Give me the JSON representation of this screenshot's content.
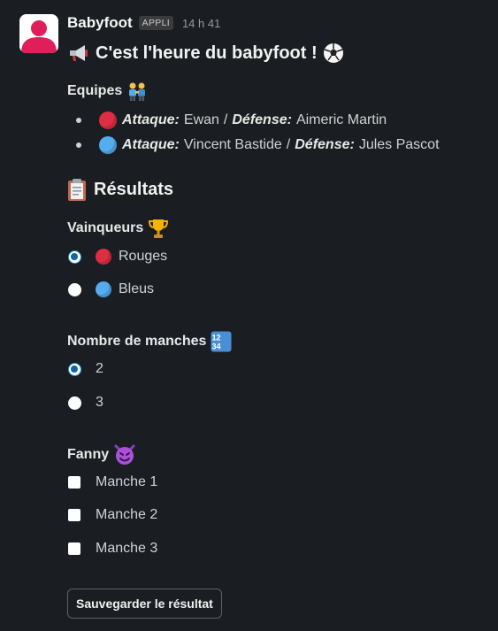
{
  "message": {
    "sender": "Babyfoot",
    "app_badge": "APPLI",
    "time": "14 h 41",
    "title_text": "C'est l'heure du babyfoot !",
    "title_icons": [
      "megaphone-icon",
      "soccer-ball-icon"
    ]
  },
  "teams": {
    "label": "Equipes",
    "label_icon": "two-people-icon",
    "items": [
      {
        "color_icon": "red-circle-icon",
        "color": "#dd2e44",
        "attack_label": "Attaque:",
        "attack": "Ewan",
        "separator": "/",
        "defense_label": "Défense:",
        "defense": "Aimeric Martin"
      },
      {
        "color_icon": "blue-circle-icon",
        "color": "#55acee",
        "attack_label": "Attaque:",
        "attack": "Vincent Bastide",
        "separator": "/",
        "defense_label": "Défense:",
        "defense": "Jules Pascot"
      }
    ]
  },
  "results": {
    "heading": "Résultats",
    "heading_icon": "clipboard-icon",
    "winners": {
      "label": "Vainqueurs",
      "label_icon": "trophy-icon",
      "options": [
        {
          "label": "Rouges",
          "color": "#dd2e44",
          "selected": true
        },
        {
          "label": "Bleus",
          "color": "#55acee",
          "selected": false
        }
      ]
    },
    "rounds": {
      "label": "Nombre de manches",
      "label_icon": "numbers-1234-icon",
      "icon_text": "1234",
      "options": [
        {
          "label": "2",
          "selected": true
        },
        {
          "label": "3",
          "selected": false
        }
      ]
    },
    "fanny": {
      "label": "Fanny",
      "label_icon": "smiling-imp-icon",
      "options": [
        {
          "label": "Manche 1",
          "checked": false
        },
        {
          "label": "Manche 2",
          "checked": false
        },
        {
          "label": "Manche 3",
          "checked": false
        }
      ]
    }
  },
  "save_button_label": "Sauvegarder le résultat",
  "colors": {
    "background": "#1a1d21",
    "avatar_accent": "#e01e5a",
    "radio_selected": "#1264a3",
    "button_border": "#5f6164"
  }
}
